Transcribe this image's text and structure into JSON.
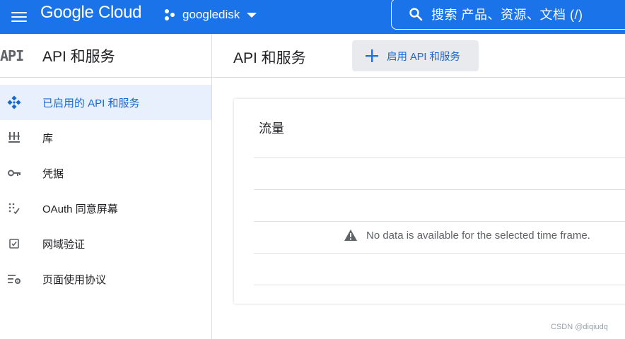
{
  "topbar": {
    "logo": "Google Cloud",
    "project": "googledisk",
    "search_placeholder": "搜索  产品、资源、文档 (/)"
  },
  "sidebar": {
    "badge": "API",
    "title": "API 和服务",
    "items": [
      {
        "label": "已启用的 API 和服务",
        "icon": "enabled-apis-icon",
        "active": true
      },
      {
        "label": "库",
        "icon": "library-icon",
        "active": false
      },
      {
        "label": "凭据",
        "icon": "key-icon",
        "active": false
      },
      {
        "label": "OAuth 同意屏幕",
        "icon": "oauth-consent-icon",
        "active": false
      },
      {
        "label": "网域验证",
        "icon": "checkbox-icon",
        "active": false
      },
      {
        "label": "页面使用协议",
        "icon": "settings-list-icon",
        "active": false
      }
    ]
  },
  "main": {
    "title": "API 和服务",
    "enable_button": "启用 API 和服务",
    "card": {
      "title": "流量",
      "no_data": "No data is available for the selected time frame."
    }
  },
  "watermark": "CSDN @diqiudq",
  "colors": {
    "brand_blue": "#1a73e8",
    "active_bg": "#e8f0fe",
    "active_text": "#1967d2"
  }
}
